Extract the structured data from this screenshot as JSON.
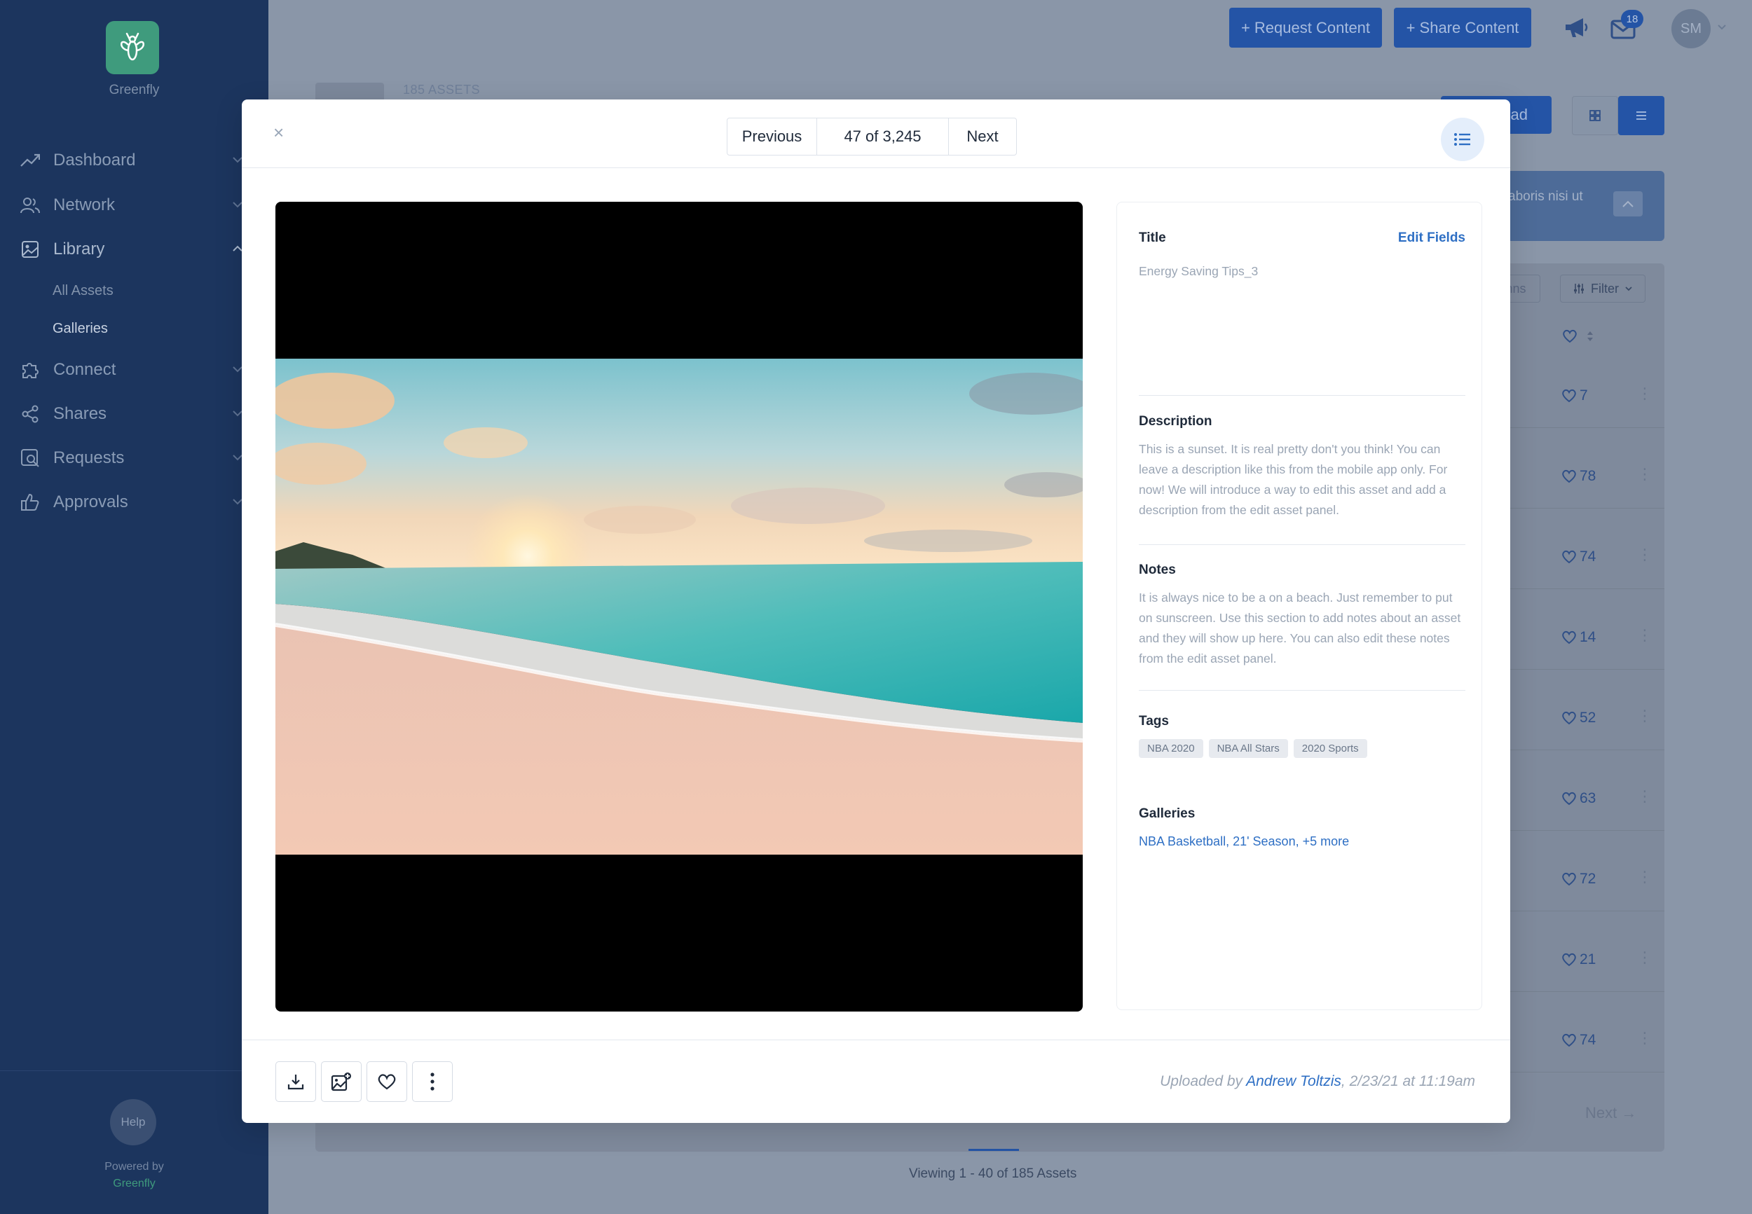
{
  "app": {
    "name": "Greenfly"
  },
  "sidebar": {
    "items": [
      {
        "label": "Dashboard",
        "icon": "trend-icon"
      },
      {
        "label": "Network",
        "icon": "users-icon"
      },
      {
        "label": "Library",
        "icon": "image-icon"
      },
      {
        "label": "Connect",
        "icon": "puzzle-icon"
      },
      {
        "label": "Shares",
        "icon": "share-icon"
      },
      {
        "label": "Requests",
        "icon": "image-search-icon"
      },
      {
        "label": "Approvals",
        "icon": "thumbs-up-icon"
      }
    ],
    "library_sub": [
      "All Assets",
      "Galleries"
    ],
    "help": "Help",
    "powered_by": "Powered by",
    "powered_brand": "Greenfly"
  },
  "topbar": {
    "request_content": "+ Request Content",
    "share_content": "+ Share Content",
    "mail_count": "18",
    "avatar_initials": "SM"
  },
  "background": {
    "assets_count": "185 ASSETS",
    "upload_label": "ad",
    "alert_text": "aboris nisi ut",
    "columns_label": "nns",
    "filter_label": "Filter",
    "likes": [
      "7",
      "78",
      "74",
      "14",
      "52",
      "63",
      "72",
      "21",
      "74"
    ],
    "next_label": "Next",
    "viewing": "Viewing 1 - 40 of 185 Assets"
  },
  "modal": {
    "close": "×",
    "pager": {
      "previous": "Previous",
      "count": "47 of 3,245",
      "next": "Next"
    },
    "details": {
      "title_label": "Title",
      "edit_fields": "Edit Fields",
      "title_value": "Energy Saving Tips_3",
      "description_label": "Description",
      "description": "This is a sunset. It is real pretty don't you think! You can leave a description like this from the mobile app only. For now! We will introduce a way to edit this asset and add a description from the edit asset panel.",
      "notes_label": "Notes",
      "notes": "It is always nice to be a on a beach. Just remember to put on sunscreen. Use this section to add notes about an asset and they will show up here. You can also edit these notes from the edit asset panel.",
      "tags_label": "Tags",
      "tags": [
        "NBA 2020",
        "NBA All Stars",
        "2020 Sports"
      ],
      "galleries_label": "Galleries",
      "galleries": "NBA Basketball, 21' Season, +5 more"
    },
    "footer": {
      "uploaded_prefix": "Uploaded by ",
      "uploader": "Andrew Toltzis",
      "uploaded_suffix": ", 2/23/21 at 11:19am"
    }
  },
  "colors": {
    "accent": "#2e6fc4",
    "sidebar": "#1c355e",
    "brand_green": "#3f9b7d",
    "primary_button": "#2454a6"
  }
}
